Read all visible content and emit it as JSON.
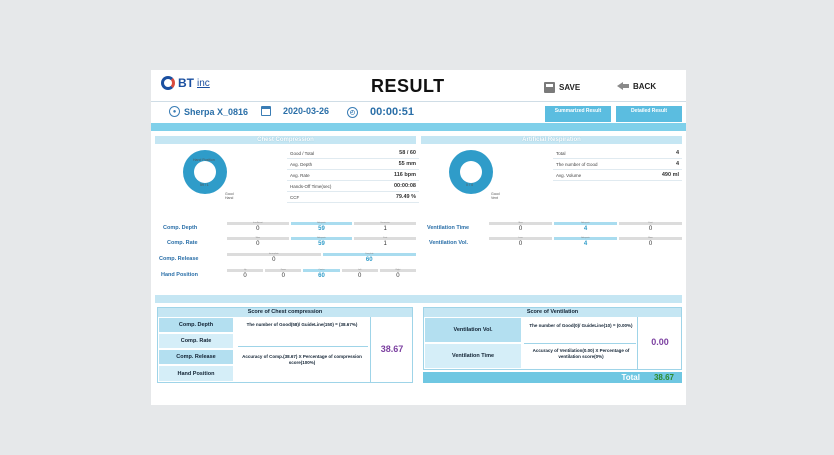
{
  "header": {
    "logo_bt": "BT",
    "logo_inc": "inc",
    "title": "RESULT",
    "save_label": "SAVE",
    "back_label": "BACK"
  },
  "info": {
    "user": "Sherpa X_0816",
    "date": "2020-03-26",
    "time": "00:00:51"
  },
  "tabs": {
    "summarized": "Summarized Result",
    "detailed": "Detailed Result"
  },
  "chest": {
    "title": "Chest Compression",
    "donut_top": "Hand Position",
    "donut_bottom": "59 / 1",
    "donut_foot": "Good Hand",
    "stats": [
      {
        "k": "Good / Total",
        "v": "58 / 60"
      },
      {
        "k": "Avg. Depth",
        "v": "55 mm"
      },
      {
        "k": "Avg. Rate",
        "v": "116 bpm"
      },
      {
        "k": "Hands-Off Time(sec)",
        "v": "00:00:08"
      },
      {
        "k": "CCF",
        "v": "79.49 %"
      }
    ],
    "rows": [
      {
        "label": "Comp. Depth",
        "heads": [
          "Insufficient",
          "Adequate",
          "Excessive"
        ],
        "vals": [
          "0",
          "59",
          "1"
        ],
        "on": 1
      },
      {
        "label": "Comp. Rate",
        "heads": [
          "Slow",
          "Adequate",
          "Fast"
        ],
        "vals": [
          "0",
          "59",
          "1"
        ],
        "on": 1
      },
      {
        "label": "Comp. Release",
        "heads": [
          "Incomplete",
          "Complete"
        ],
        "vals": [
          "0",
          "60"
        ],
        "on": 1
      },
      {
        "label": "Hand Position",
        "heads": [
          "Up",
          "Down",
          "Center",
          "Left",
          "Right"
        ],
        "vals": [
          "0",
          "0",
          "60",
          "0",
          "0"
        ],
        "on": 2
      }
    ]
  },
  "resp": {
    "title": "Artificial Respiration",
    "donut_bottom": "0 / 4",
    "donut_foot": "Good Vent",
    "stats": [
      {
        "k": "Total",
        "v": "4"
      },
      {
        "k": "The number of Good",
        "v": "4"
      },
      {
        "k": "Avg. Volume",
        "v": "490 ml"
      }
    ],
    "rows": [
      {
        "label": "Ventilation Time",
        "heads": [
          "Slow",
          "Adequate",
          "Fast"
        ],
        "vals": [
          "0",
          "4",
          "0"
        ],
        "on": 1
      },
      {
        "label": "Ventilation Vol.",
        "heads": [
          "Less",
          "Adequate",
          "More"
        ],
        "vals": [
          "0",
          "4",
          "0"
        ],
        "on": 1
      }
    ]
  },
  "score_chest": {
    "title": "Score of Chest compression",
    "labels": [
      "Comp. Depth",
      "Comp. Rate",
      "Comp. Release",
      "Hand Position"
    ],
    "formula1": "The number of Good(58)/ GuideLine(150) = (38.67%)",
    "formula2": "Accuracy of Comp.(38.67) X Percentage of compression score(100%)",
    "score": "38.67"
  },
  "score_vent": {
    "title": "Score of Ventilation",
    "labels": [
      "Ventilation Vol.",
      "Ventilation Time"
    ],
    "formula1": "The number of Good(0)/ GuideLine(10) = (0.00%)",
    "formula2": "Accuracy of Ventilation(0.00) X Percentage of ventilation score(0%)",
    "score": "0.00"
  },
  "total": {
    "label": "Total",
    "value": "38.67"
  }
}
